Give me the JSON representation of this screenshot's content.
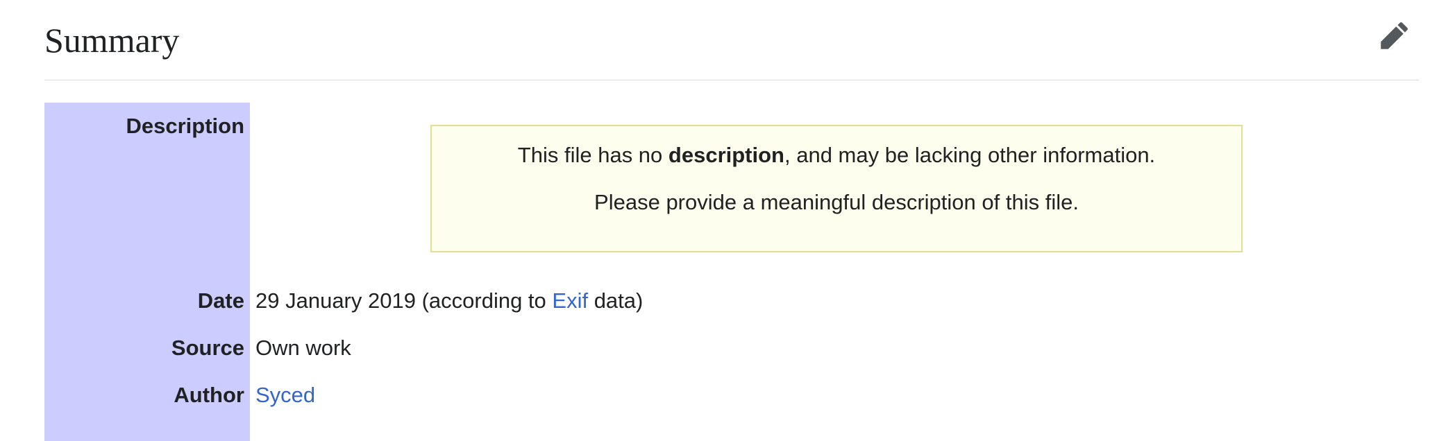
{
  "section": {
    "title": "Summary",
    "edit_icon": "pencil-icon"
  },
  "notice": {
    "before_bold": "This file has no ",
    "bold": "description",
    "after_bold": ", and may be lacking other information.",
    "line2": "Please provide a meaningful description of this file.",
    "background": "#fefeee",
    "border": "#e0e095"
  },
  "rows": {
    "description_label": "Description",
    "date_label": "Date",
    "date_before_link": "29 January 2019 (according to ",
    "date_link": "Exif",
    "date_after_link": " data)",
    "source_label": "Source",
    "source_value": "Own work",
    "author_label": "Author",
    "author_value": "Syced"
  },
  "colors": {
    "label_background": "#ccccff",
    "link": "#3366cc",
    "text": "#202122"
  }
}
